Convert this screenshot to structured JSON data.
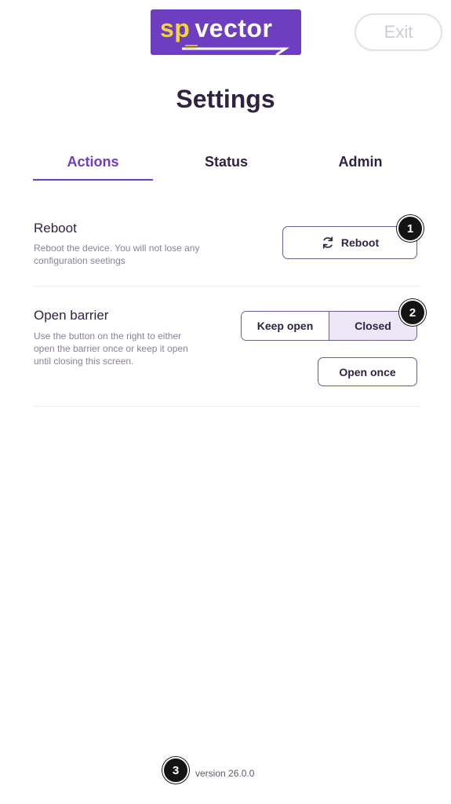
{
  "header": {
    "logo": {
      "left_text": "sp",
      "right_text": "vector",
      "colors": {
        "background": "#6d3fc0",
        "accent": "#f5d33a"
      }
    },
    "exit_label": "Exit"
  },
  "page_title": "Settings",
  "tabs": [
    {
      "label": "Actions",
      "active": true
    },
    {
      "label": "Status",
      "active": false
    },
    {
      "label": "Admin",
      "active": false
    }
  ],
  "sections": {
    "reboot": {
      "title": "Reboot",
      "description": "Reboot the device. You will not lose any configuration seetings",
      "button_label": "Reboot",
      "button_icon": "refresh-icon"
    },
    "barrier": {
      "title": "Open barrier",
      "description": "Use the button on the right to either open the barrier once or keep it open until closing this screen.",
      "toggle": {
        "options": [
          "Keep open",
          "Closed"
        ],
        "selected": "Closed"
      },
      "open_once_label": "Open once"
    }
  },
  "annotations": [
    "1",
    "2",
    "3"
  ],
  "footer": {
    "version": "version 26.0.0"
  }
}
